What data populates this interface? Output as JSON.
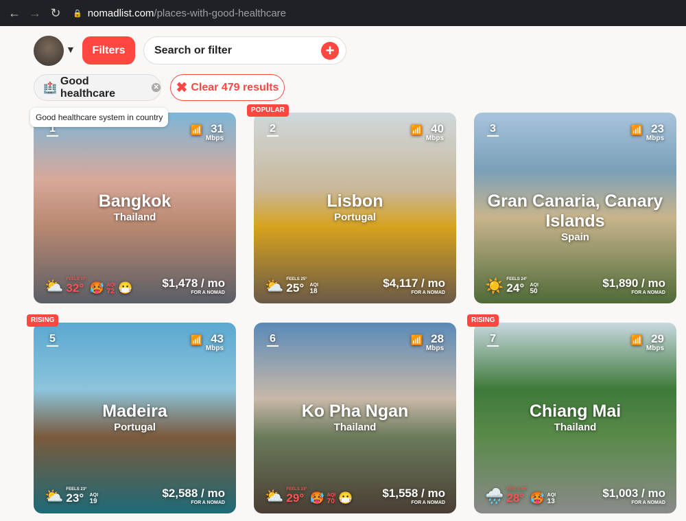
{
  "browser": {
    "url_domain": "nomadlist.com",
    "url_path": "/places-with-good-healthcare"
  },
  "toolbar": {
    "filters_label": "Filters",
    "search_placeholder": "Search or filter"
  },
  "active_filter": {
    "label": "Good healthcare",
    "tooltip": "Good healthcare system in country"
  },
  "clear_label": "Clear 479 results",
  "cards": [
    {
      "rank": "1",
      "speed": "31",
      "unit": "Mbps",
      "city": "Bangkok",
      "country": "Thailand",
      "feels": "FEELS 37°",
      "temp": "32°",
      "aqi_label": "AQI",
      "aqi": "72",
      "price": "$1,478 / mo",
      "price_sub": "FOR A NOMAD",
      "weather": "partly-cloudy",
      "badge": ""
    },
    {
      "rank": "2",
      "speed": "40",
      "unit": "Mbps",
      "city": "Lisbon",
      "country": "Portugal",
      "feels": "FEELS 25°",
      "temp": "25°",
      "aqi_label": "AQI",
      "aqi": "18",
      "price": "$4,117 / mo",
      "price_sub": "FOR A NOMAD",
      "weather": "partly-cloudy",
      "badge": "POPULAR"
    },
    {
      "rank": "3",
      "speed": "23",
      "unit": "Mbps",
      "city": "Gran Canaria, Canary Islands",
      "country": "Spain",
      "feels": "FEELS 24°",
      "temp": "24°",
      "aqi_label": "AQI",
      "aqi": "50",
      "price": "$1,890 / mo",
      "price_sub": "FOR A NOMAD",
      "weather": "sunny",
      "badge": ""
    },
    {
      "rank": "5",
      "speed": "43",
      "unit": "Mbps",
      "city": "Madeira",
      "country": "Portugal",
      "feels": "FEELS 23°",
      "temp": "23°",
      "aqi_label": "AQI",
      "aqi": "19",
      "price": "$2,588 / mo",
      "price_sub": "FOR A NOMAD",
      "weather": "partly-cloudy",
      "badge": "RISING"
    },
    {
      "rank": "6",
      "speed": "28",
      "unit": "Mbps",
      "city": "Ko Pha Ngan",
      "country": "Thailand",
      "feels": "FEELS 33°",
      "temp": "29°",
      "aqi_label": "AQI",
      "aqi": "70",
      "price": "$1,558 / mo",
      "price_sub": "FOR A NOMAD",
      "weather": "partly-cloudy",
      "badge": ""
    },
    {
      "rank": "7",
      "speed": "29",
      "unit": "Mbps",
      "city": "Chiang Mai",
      "country": "Thailand",
      "feels": "FEELS 32°",
      "temp": "28°",
      "aqi_label": "AQI",
      "aqi": "13",
      "price": "$1,003 / mo",
      "price_sub": "FOR A NOMAD",
      "weather": "rain",
      "badge": "RISING"
    }
  ],
  "colors": {
    "accent": "#ff4742"
  }
}
